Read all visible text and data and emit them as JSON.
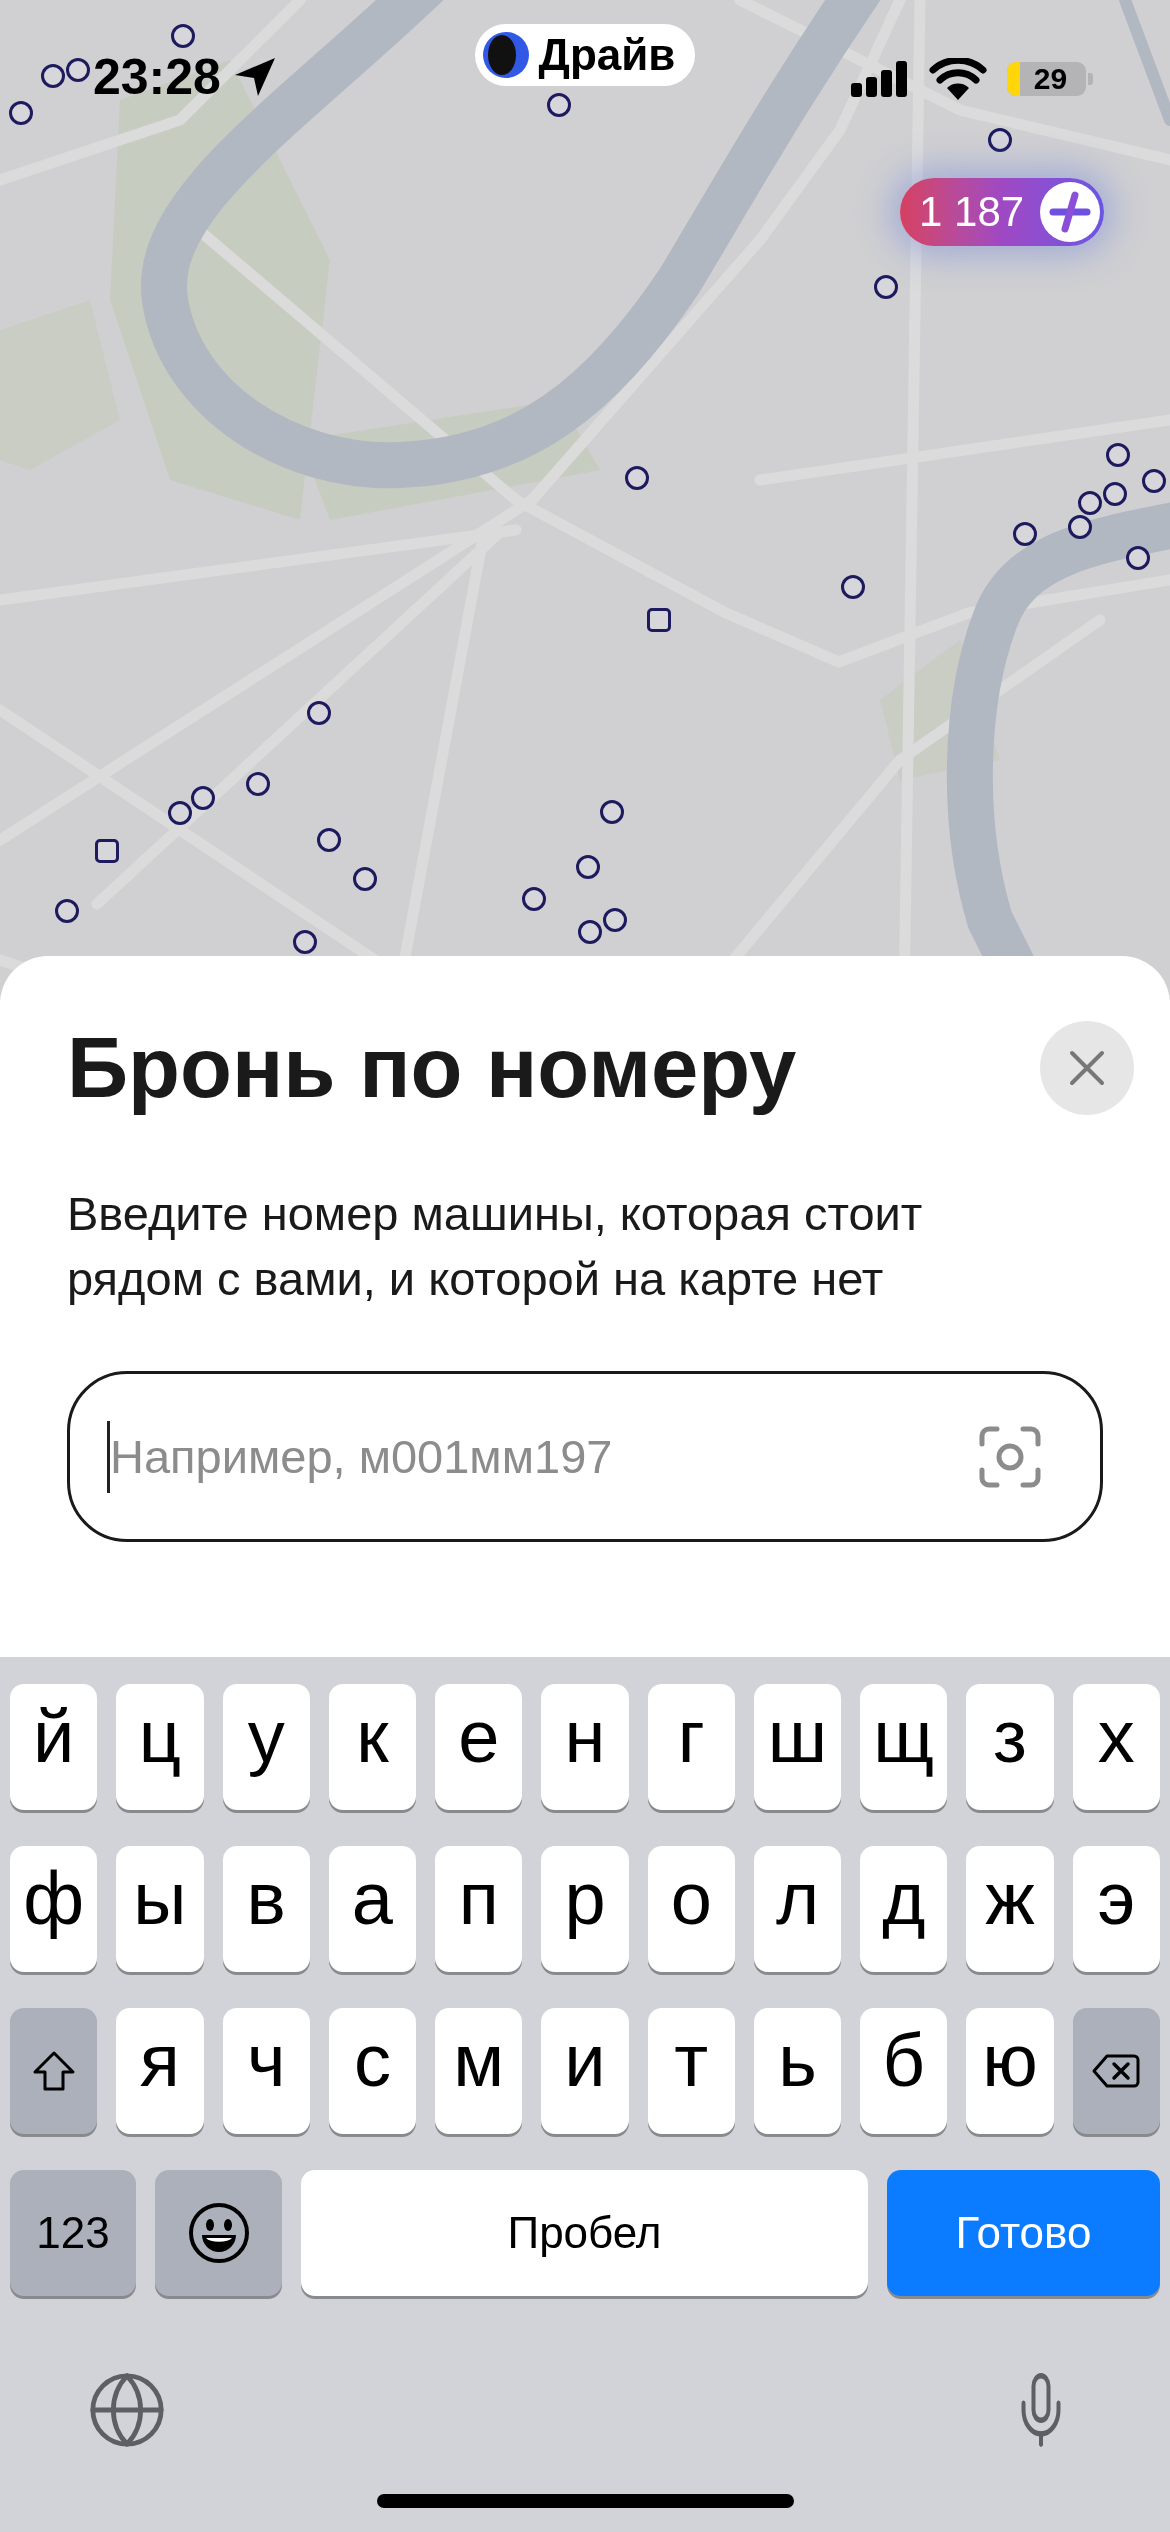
{
  "status_bar": {
    "time": "23:28",
    "app_pill": {
      "label": "Драйв"
    },
    "battery_text": "29"
  },
  "points_badge": {
    "value": "1 187"
  },
  "sheet": {
    "title": "Бронь по номеру",
    "description": "Введите номер машины, которая стоит рядом с вами, и которой на карте нет",
    "plate_field": {
      "placeholder": "Например, м001мм197",
      "focused": true
    }
  },
  "keyboard": {
    "rows": [
      [
        {
          "kind": "letter",
          "label": "й"
        },
        {
          "kind": "letter",
          "label": "ц"
        },
        {
          "kind": "letter",
          "label": "у"
        },
        {
          "kind": "letter",
          "label": "к"
        },
        {
          "kind": "letter",
          "label": "е"
        },
        {
          "kind": "letter",
          "label": "н"
        },
        {
          "kind": "letter",
          "label": "г"
        },
        {
          "kind": "letter",
          "label": "ш"
        },
        {
          "kind": "letter",
          "label": "щ"
        },
        {
          "kind": "letter",
          "label": "з"
        },
        {
          "kind": "letter",
          "label": "х"
        }
      ],
      [
        {
          "kind": "letter",
          "label": "ф"
        },
        {
          "kind": "letter",
          "label": "ы"
        },
        {
          "kind": "letter",
          "label": "в"
        },
        {
          "kind": "letter",
          "label": "а"
        },
        {
          "kind": "letter",
          "label": "п"
        },
        {
          "kind": "letter",
          "label": "р"
        },
        {
          "kind": "letter",
          "label": "о"
        },
        {
          "kind": "letter",
          "label": "л"
        },
        {
          "kind": "letter",
          "label": "д"
        },
        {
          "kind": "letter",
          "label": "ж"
        },
        {
          "kind": "letter",
          "label": "э"
        }
      ],
      [
        {
          "kind": "shift"
        },
        {
          "kind": "letter",
          "label": "я"
        },
        {
          "kind": "letter",
          "label": "ч"
        },
        {
          "kind": "letter",
          "label": "с"
        },
        {
          "kind": "letter",
          "label": "м"
        },
        {
          "kind": "letter",
          "label": "и"
        },
        {
          "kind": "letter",
          "label": "т"
        },
        {
          "kind": "letter",
          "label": "ь"
        },
        {
          "kind": "letter",
          "label": "б"
        },
        {
          "kind": "letter",
          "label": "ю"
        },
        {
          "kind": "delete"
        }
      ]
    ],
    "numbers_key": "123",
    "space_key": "Пробел",
    "return_key": "Готово"
  }
}
